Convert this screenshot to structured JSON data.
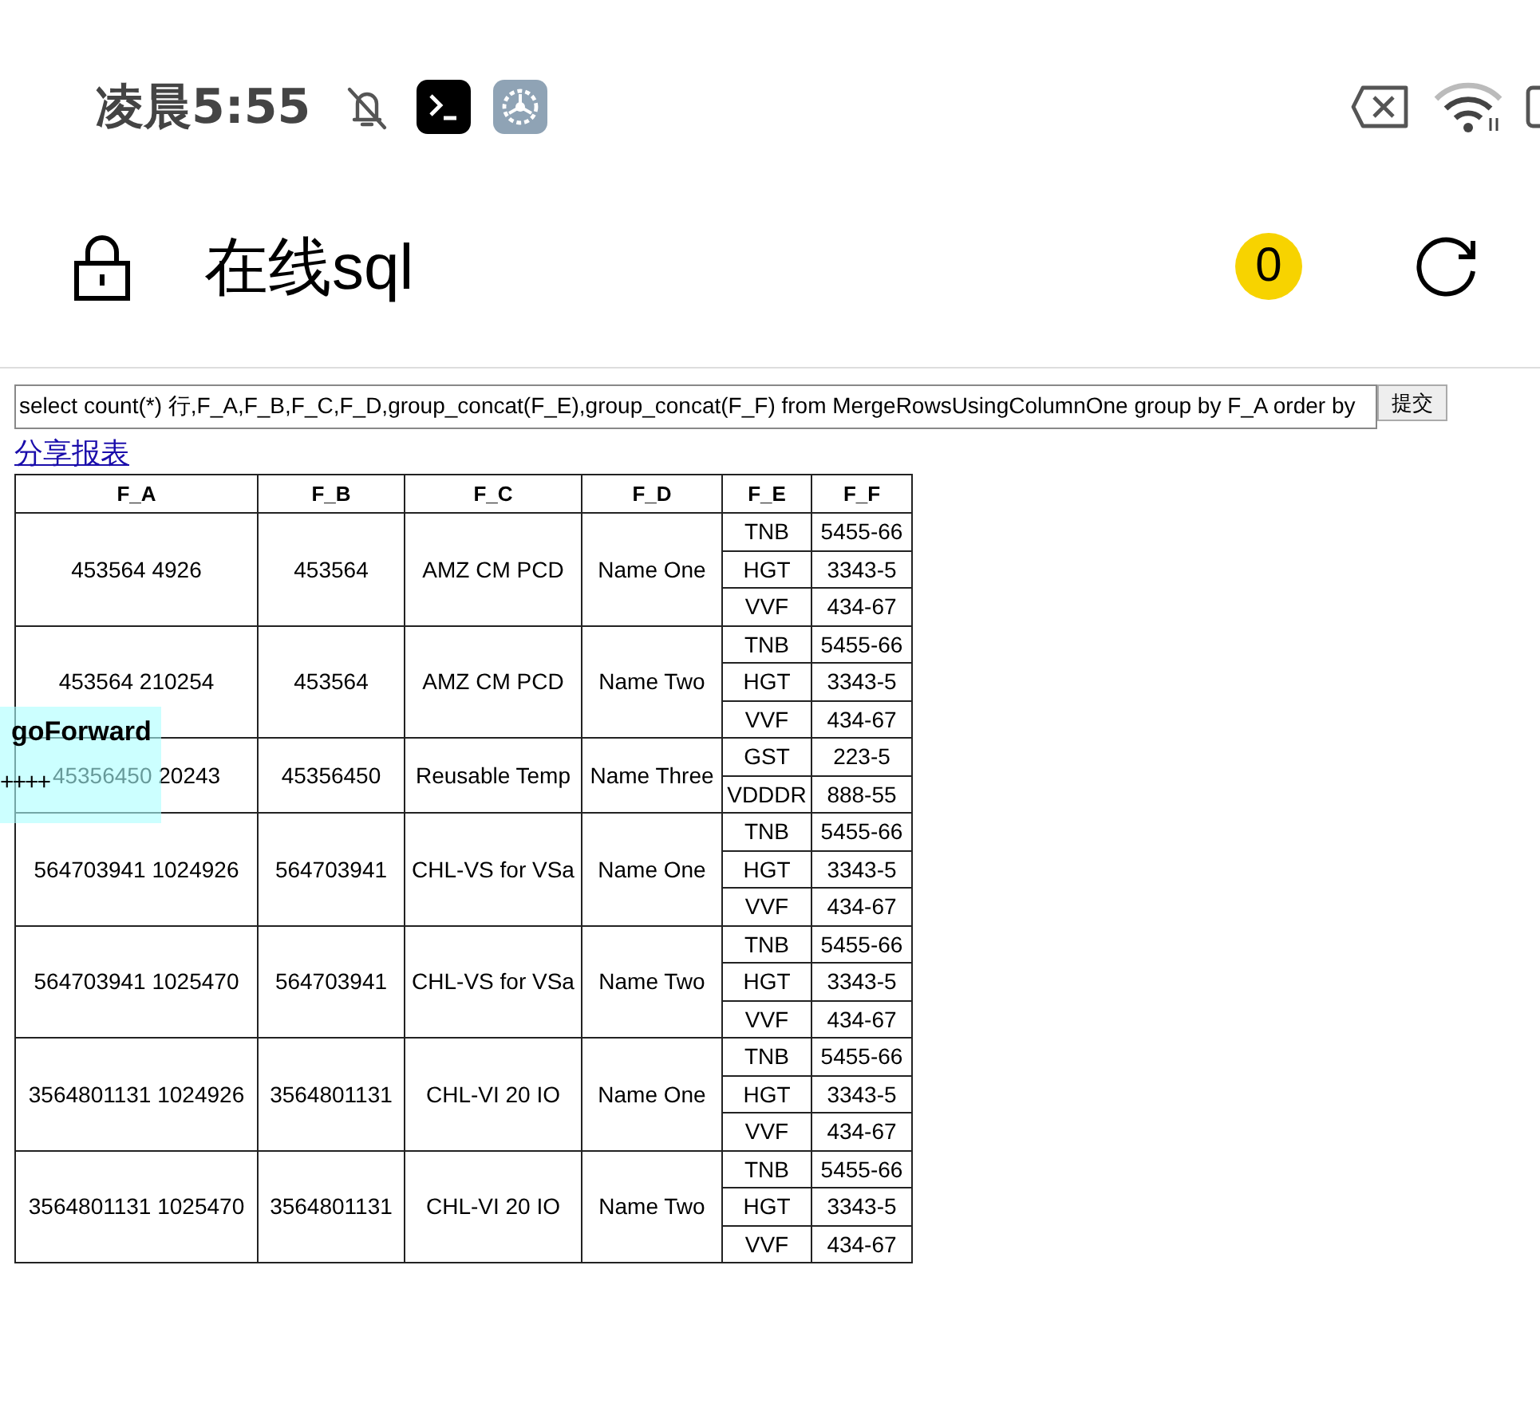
{
  "status_bar": {
    "time": "凌晨5:55"
  },
  "app_bar": {
    "title": "在线sql",
    "badge": "0"
  },
  "query": {
    "value": "select count(*) 行,F_A,F_B,F_C,F_D,group_concat(F_E),group_concat(F_F) from MergeRowsUsingColumnOne group by F_A order by",
    "button": "提交"
  },
  "share_link": "分享报表",
  "table": {
    "columns": [
      "F_A",
      "F_B",
      "F_C",
      "F_D",
      "F_E",
      "F_F"
    ],
    "rows": [
      {
        "cells": [
          "453564 4926",
          "453564",
          "AMZ CM PCD",
          "Name One"
        ],
        "subrows": [
          [
            "TNB",
            "5455-66"
          ],
          [
            "HGT",
            "3343-5"
          ],
          [
            "VVF",
            "434-67"
          ]
        ]
      },
      {
        "cells": [
          "453564 210254",
          "453564",
          "AMZ CM PCD",
          "Name Two"
        ],
        "subrows": [
          [
            "TNB",
            "5455-66"
          ],
          [
            "HGT",
            "3343-5"
          ],
          [
            "VVF",
            "434-67"
          ]
        ]
      },
      {
        "cells": [
          "45356450 20243",
          "45356450",
          "Reusable Temp",
          "Name Three"
        ],
        "subrows": [
          [
            "GST",
            "223-5"
          ],
          [
            "VDDDR",
            "888-55"
          ]
        ]
      },
      {
        "cells": [
          "564703941 1024926",
          "564703941",
          "CHL-VS for VSa",
          "Name One"
        ],
        "subrows": [
          [
            "TNB",
            "5455-66"
          ],
          [
            "HGT",
            "3343-5"
          ],
          [
            "VVF",
            "434-67"
          ]
        ]
      },
      {
        "cells": [
          "564703941 1025470",
          "564703941",
          "CHL-VS for VSa",
          "Name Two"
        ],
        "subrows": [
          [
            "TNB",
            "5455-66"
          ],
          [
            "HGT",
            "3343-5"
          ],
          [
            "VVF",
            "434-67"
          ]
        ]
      },
      {
        "cells": [
          "3564801131 1024926",
          "3564801131",
          "CHL-VI 20 IO",
          "Name One"
        ],
        "subrows": [
          [
            "TNB",
            "5455-66"
          ],
          [
            "HGT",
            "3343-5"
          ],
          [
            "VVF",
            "434-67"
          ]
        ]
      },
      {
        "cells": [
          "3564801131 1025470",
          "3564801131",
          "CHL-VI 20 IO",
          "Name Two"
        ],
        "subrows": [
          [
            "TNB",
            "5455-66"
          ],
          [
            "HGT",
            "3343-5"
          ],
          [
            "VVF",
            "434-67"
          ]
        ]
      }
    ]
  },
  "overlay": {
    "title": "goForward",
    "text": "++++"
  }
}
